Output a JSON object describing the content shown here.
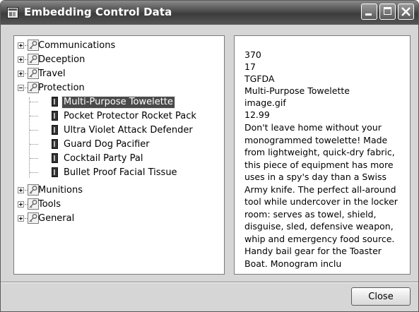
{
  "window": {
    "title": "Embedding Control Data",
    "controls": {
      "minimize": "minimize",
      "maximize": "maximize",
      "close": "close"
    }
  },
  "tree": {
    "nodes": [
      {
        "label": "Communications",
        "expanded": false,
        "icon": "key-icon"
      },
      {
        "label": "Deception",
        "expanded": false,
        "icon": "key-icon"
      },
      {
        "label": "Travel",
        "expanded": false,
        "icon": "key-icon"
      },
      {
        "label": "Protection",
        "expanded": true,
        "icon": "key-icon",
        "children": [
          {
            "label": "Multi-Purpose Towelette",
            "selected": true,
            "icon": "book-icon"
          },
          {
            "label": "Pocket Protector Rocket Pack",
            "icon": "book-icon"
          },
          {
            "label": "Ultra Violet Attack Defender",
            "icon": "book-icon"
          },
          {
            "label": "Guard Dog Pacifier",
            "icon": "book-icon"
          },
          {
            "label": "Cocktail Party Pal",
            "icon": "book-icon"
          },
          {
            "label": "Bullet Proof Facial Tissue",
            "icon": "book-icon"
          }
        ]
      },
      {
        "label": "Munitions",
        "expanded": false,
        "icon": "key-icon"
      },
      {
        "label": "Tools",
        "expanded": false,
        "icon": "key-icon"
      },
      {
        "label": "General",
        "expanded": false,
        "icon": "key-icon"
      }
    ]
  },
  "detail": {
    "id": "370",
    "category_id": "17",
    "model_number": "TGFDA",
    "model_name": "Multi-Purpose Towelette",
    "image": "image.gif",
    "price": "12.99",
    "description": "Don't leave home without your monogrammed towelette! Made from lightweight, quick-dry fabric, this piece of equipment has more uses in a spy's day than a Swiss Army knife. The perfect all-around tool while undercover in the locker room: serves as towel, shield, disguise, sled, defensive weapon, whip and emergency food source. Handy bail gear for the Toaster Boat. Monogram inclu"
  },
  "footer": {
    "close_label": "Close"
  }
}
